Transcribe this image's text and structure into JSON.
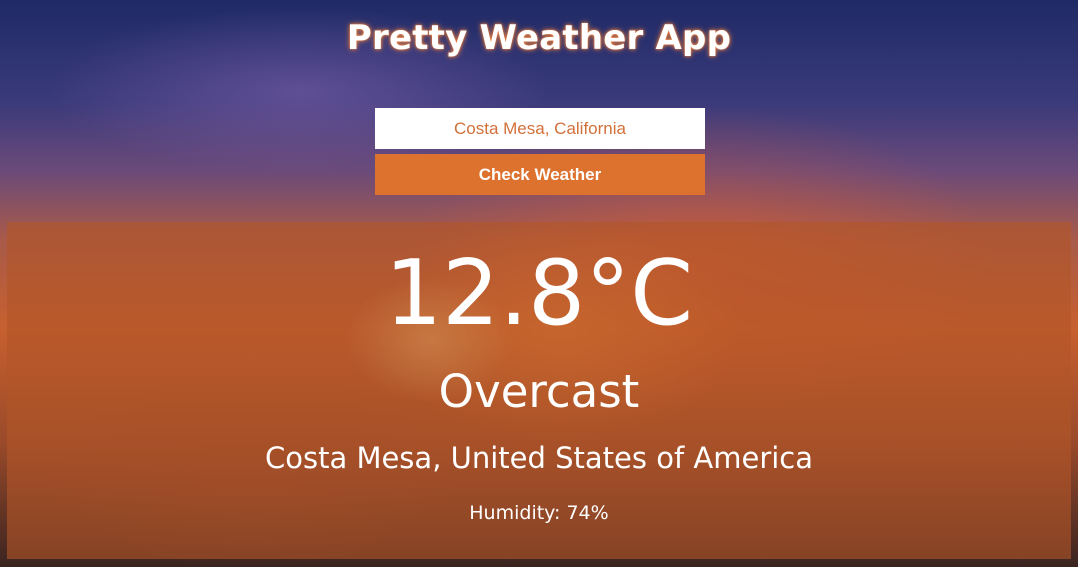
{
  "app": {
    "title": "Pretty Weather App"
  },
  "search": {
    "value": "Costa Mesa, California",
    "button_label": "Check Weather"
  },
  "weather": {
    "temperature": "12.8°C",
    "condition": "Overcast",
    "location": "Costa Mesa, United States of America",
    "humidity": "Humidity: 74%"
  },
  "colors": {
    "accent": "#dc722e",
    "input_text": "#d2703a",
    "panel": "#b25628"
  }
}
